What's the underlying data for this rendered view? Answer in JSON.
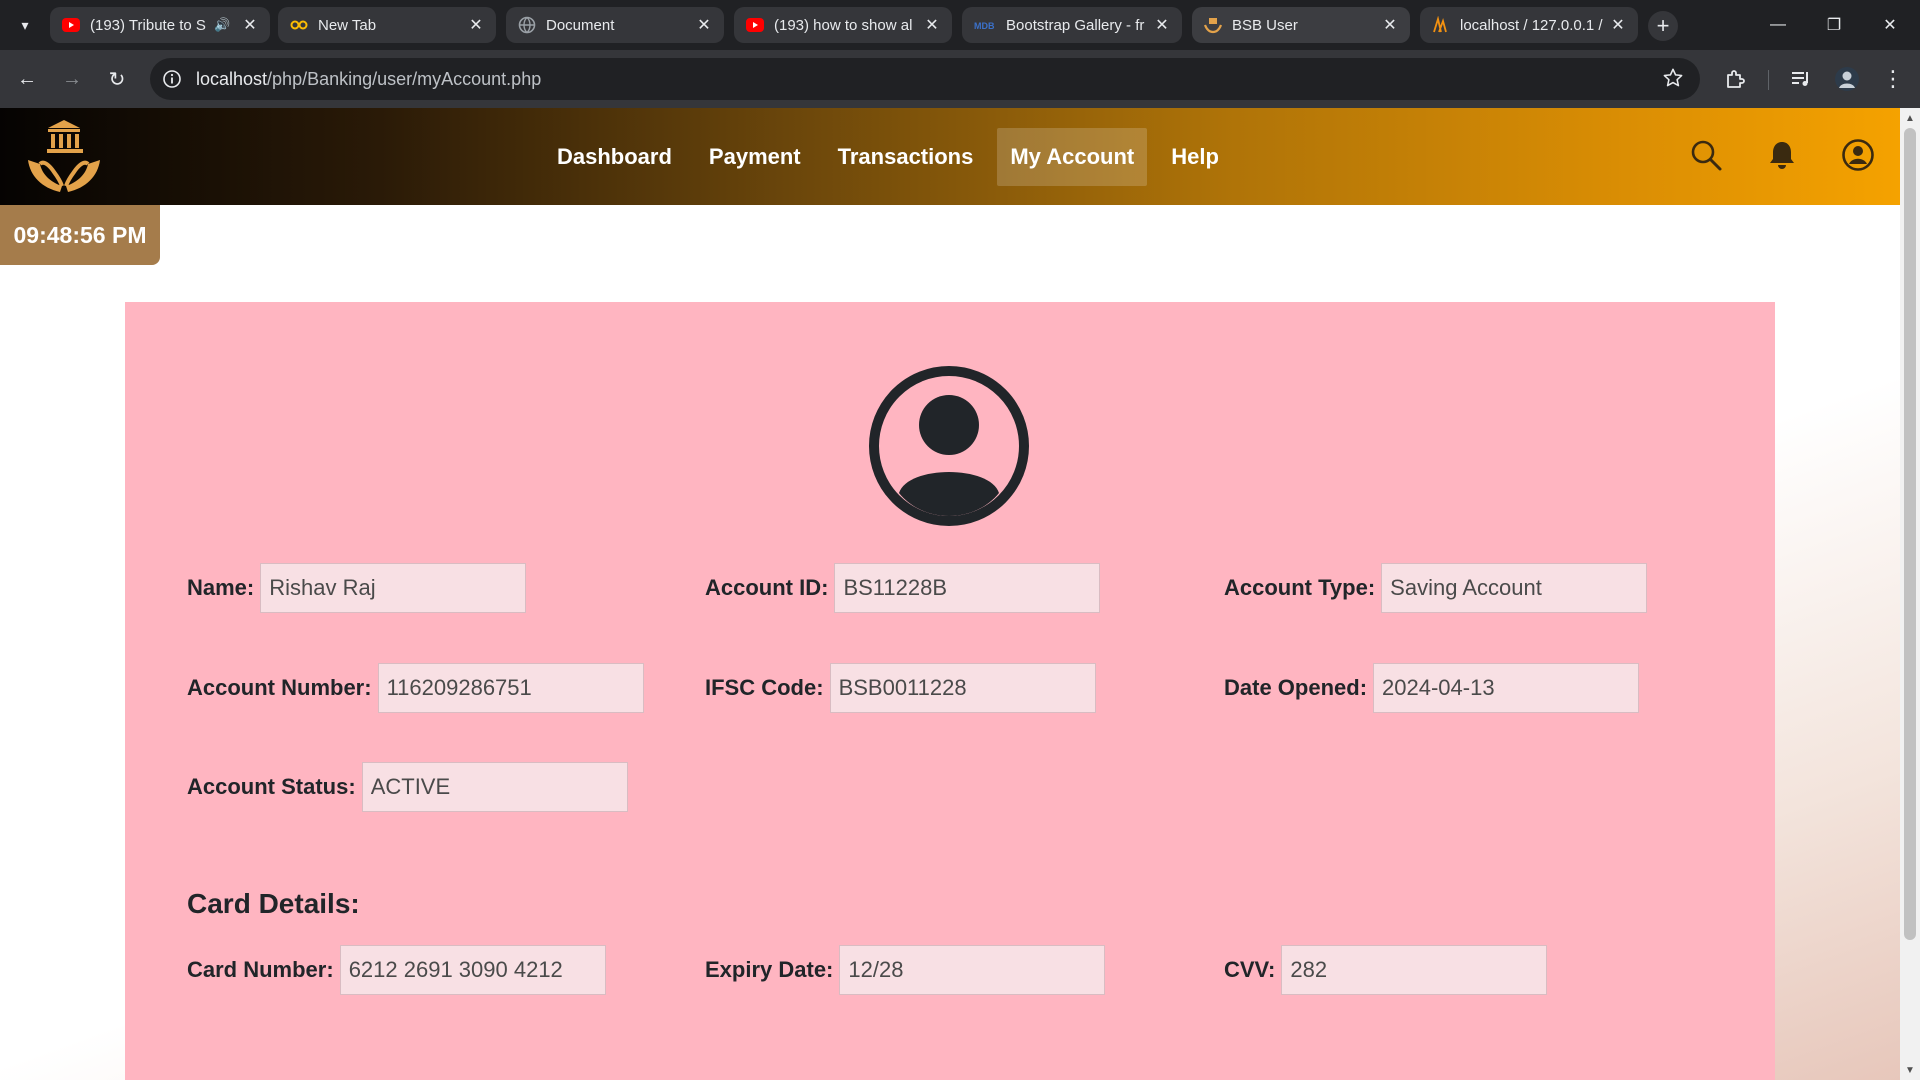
{
  "browser": {
    "tabs": [
      {
        "title": "(193) Tribute to S",
        "favicon": "youtube-icon",
        "audio": true
      },
      {
        "title": "New Tab",
        "favicon": "infinity-icon"
      },
      {
        "title": "Document",
        "favicon": "globe-icon"
      },
      {
        "title": "(193) how to show al",
        "favicon": "youtube-icon"
      },
      {
        "title": "Bootstrap Gallery - fr",
        "favicon": "mdb-icon"
      },
      {
        "title": "BSB User",
        "favicon": "bank-icon",
        "active": true
      },
      {
        "title": "localhost / 127.0.0.1 /",
        "favicon": "phpmyadmin-icon"
      }
    ],
    "url_host": "localhost",
    "url_path": "/php/Banking/user/myAccount.php",
    "colors": {
      "frame": "#202124",
      "toolbar": "#35363a"
    }
  },
  "header": {
    "nav": [
      "Dashboard",
      "Payment",
      "Transactions",
      "My Account",
      "Help"
    ],
    "active_nav": "My Account",
    "icons": [
      "search-icon",
      "bell-icon",
      "user-circle-icon"
    ],
    "colors": {
      "gradient_start": "#050302",
      "gradient_end": "#f5a200",
      "logo": "#e3a24a"
    }
  },
  "clock": "09:48:56 PM",
  "account": {
    "name": {
      "label": "Name:",
      "value": "Rishav Raj"
    },
    "account_id": {
      "label": "Account ID:",
      "value": "BS11228B"
    },
    "account_type": {
      "label": "Account Type:",
      "value": "Saving Account"
    },
    "account_number": {
      "label": "Account Number:",
      "value": "116209286751"
    },
    "ifsc": {
      "label": "IFSC Code:",
      "value": "BSB0011228"
    },
    "date_opened": {
      "label": "Date Opened:",
      "value": "2024-04-13"
    },
    "status": {
      "label": "Account Status:",
      "value": "ACTIVE"
    }
  },
  "card": {
    "title": "Card Details:",
    "number": {
      "label": "Card Number:",
      "value": "6212 2691 3090 4212"
    },
    "expiry": {
      "label": "Expiry Date:",
      "value": "12/28"
    },
    "cvv": {
      "label": "CVV:",
      "value": "282"
    }
  },
  "colors": {
    "panel": "#ffb5c1",
    "input": "#f8e0e4",
    "clock_bg": "#a57c4b"
  }
}
